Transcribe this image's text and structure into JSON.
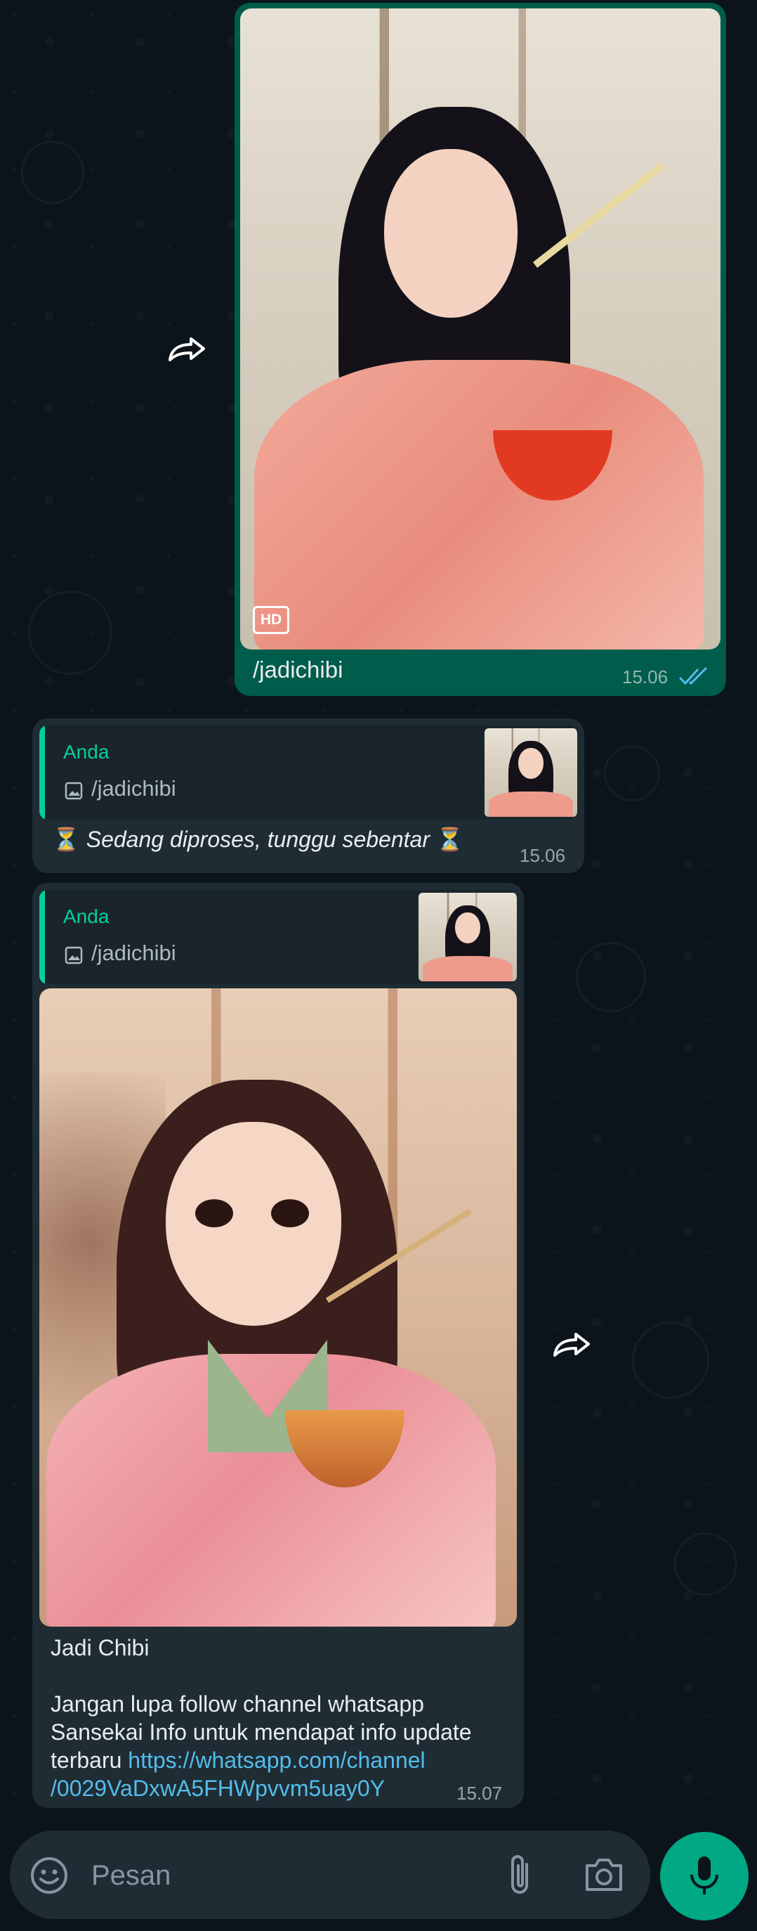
{
  "messages": {
    "sent": {
      "caption": "/jadichibi",
      "time": "15.06",
      "hd_label": "HD",
      "status": "read-double-check-icon"
    },
    "processing": {
      "quote_sender": "Anda",
      "quote_text": "/jadichibi",
      "hourglass": "⏳",
      "text": "Sedang diproses, tunggu sebentar",
      "time": "15.06"
    },
    "result": {
      "quote_sender": "Anda",
      "quote_text": "/jadichibi",
      "title": "Jadi Chibi",
      "body_line1": "Jangan lupa follow channel whatsapp",
      "body_line2": "Sansekai Info untuk mendapat info update",
      "body_line3_prefix": "terbaru ",
      "link_line1": "https://whatsapp.com/channel",
      "link_line2": "/0029VaDxwA5FHWpvvm5uay0Y",
      "time": "15.07"
    }
  },
  "composer": {
    "placeholder": "Pesan",
    "icons": [
      "emoji-icon",
      "attach-icon",
      "camera-icon",
      "mic-icon"
    ]
  },
  "colors": {
    "background": "#0b141a",
    "outgoing_bubble": "#005c4b",
    "incoming_bubble": "#1f2c34",
    "accent": "#00a884",
    "link": "#53bdeb",
    "quote_name": "#06cf9c"
  }
}
